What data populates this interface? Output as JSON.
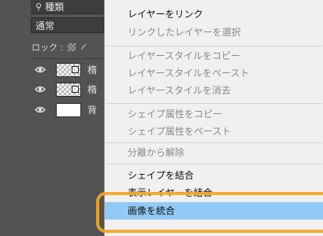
{
  "layers_panel": {
    "search_label": "種類",
    "blend_mode": "通常",
    "lock_label": "ロック :",
    "layers": [
      {
        "name": "楕",
        "visible": true,
        "thumbnail": "transparent-shape"
      },
      {
        "name": "楕",
        "visible": true,
        "thumbnail": "transparent-shape"
      },
      {
        "name": "背",
        "visible": true,
        "thumbnail": "white"
      }
    ]
  },
  "context_menu": {
    "items": [
      {
        "label": "レイヤーをリンク",
        "state": "enabled"
      },
      {
        "label": "リンクしたレイヤーを選択",
        "state": "disabled"
      },
      {
        "label": "レイヤースタイルをコピー",
        "state": "disabled"
      },
      {
        "label": "レイヤースタイルをペースト",
        "state": "disabled"
      },
      {
        "label": "レイヤースタイルを消去",
        "state": "disabled"
      },
      {
        "label": "シェイプ属性をコピー",
        "state": "disabled"
      },
      {
        "label": "シェイプ属性をペースト",
        "state": "disabled"
      },
      {
        "label": "分離から解除",
        "state": "disabled"
      },
      {
        "label": "シェイプを結合",
        "state": "enabled"
      },
      {
        "label": "表示レイヤーを結合",
        "state": "enabled"
      },
      {
        "label": "画像を統合",
        "state": "highlighted"
      }
    ]
  },
  "colors": {
    "highlight": "#91c9f7",
    "annotation": "#f4a622",
    "panel_bg": "#535353",
    "menu_bg": "#f0f0f0"
  }
}
